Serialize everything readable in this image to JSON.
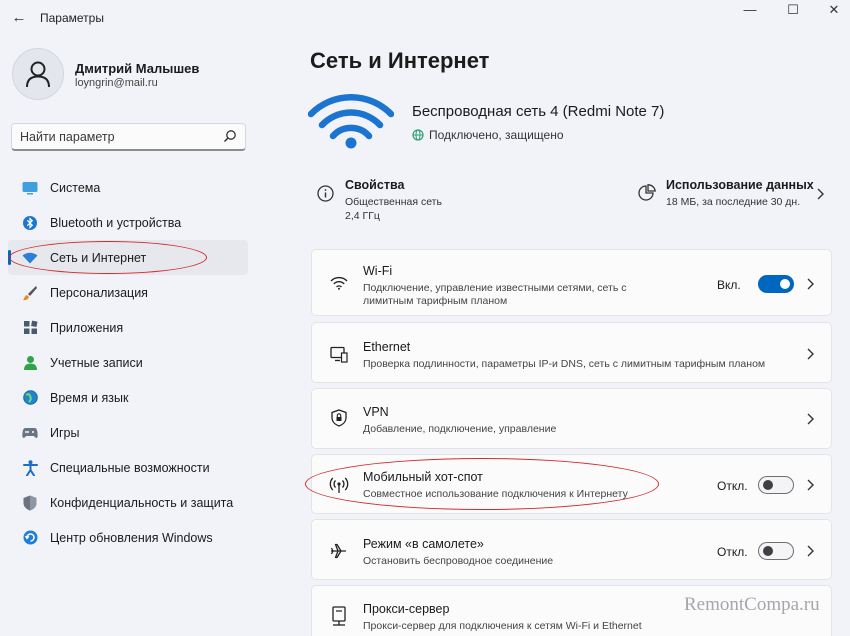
{
  "window": {
    "title": "Параметры",
    "back_symbol": "←",
    "minimize_symbol": "—",
    "maximize_symbol": "☐",
    "close_symbol": "✕"
  },
  "user": {
    "name": "Дмитрий Малышев",
    "email": "loyngrin@mail.ru"
  },
  "search": {
    "placeholder": "Найти параметр"
  },
  "sidebar": {
    "items": [
      {
        "label": "Система",
        "icon": "monitor-icon"
      },
      {
        "label": "Bluetooth и устройства",
        "icon": "bluetooth-icon"
      },
      {
        "label": "Сеть и Интернет",
        "icon": "wifi-icon",
        "active": true
      },
      {
        "label": "Персонализация",
        "icon": "brush-icon"
      },
      {
        "label": "Приложения",
        "icon": "apps-icon"
      },
      {
        "label": "Учетные записи",
        "icon": "person-icon"
      },
      {
        "label": "Время и язык",
        "icon": "globe-clock-icon"
      },
      {
        "label": "Игры",
        "icon": "gamepad-icon"
      },
      {
        "label": "Специальные возможности",
        "icon": "accessibility-icon"
      },
      {
        "label": "Конфиденциальность и защита",
        "icon": "shield-icon"
      },
      {
        "label": "Центр обновления Windows",
        "icon": "update-icon"
      }
    ]
  },
  "main": {
    "title": "Сеть и Интернет",
    "network": {
      "name": "Беспроводная сеть 4 (Redmi Note 7)",
      "status": "Подключено, защищено"
    },
    "properties": {
      "title": "Свойства",
      "line1": "Общественная сеть",
      "line2": "2,4 ГГц"
    },
    "data_usage": {
      "title": "Использование данных",
      "subtitle": "18 МБ, за последние 30 дн."
    },
    "cards": {
      "wifi": {
        "title": "Wi-Fi",
        "line1": "Подключение, управление известными сетями, сеть с",
        "line2": "лимитным тарифным планом",
        "state": "Вкл.",
        "on": true
      },
      "ethernet": {
        "title": "Ethernet",
        "subtitle": "Проверка подлинности, параметры IP-и DNS, сеть с лимитным тарифным планом"
      },
      "vpn": {
        "title": "VPN",
        "subtitle": "Добавление, подключение, управление"
      },
      "hotspot": {
        "title": "Мобильный хот-спот",
        "subtitle": "Совместное использование подключения к Интернету",
        "state": "Откл.",
        "on": false
      },
      "airplane": {
        "title": "Режим «в самолете»",
        "subtitle": "Остановить беспроводное соединение",
        "state": "Откл.",
        "on": false
      },
      "proxy": {
        "title": "Прокси-сервер",
        "subtitle": "Прокси-сервер для подключения к сетям Wi-Fi и Ethernet"
      }
    }
  },
  "watermark": "RemontCompa.ru",
  "colors": {
    "accent": "#0067c0",
    "annotation": "#d22b2b",
    "background": "#f1f3f9",
    "card": "#fbfbfc"
  }
}
